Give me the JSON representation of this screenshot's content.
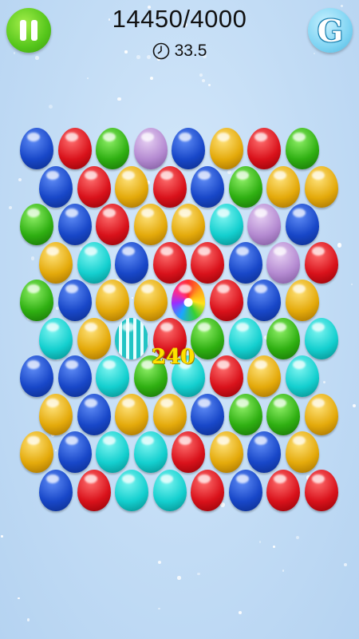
{
  "header": {
    "score": "14450/4000",
    "timer": "33.5",
    "hint_letter": "G"
  },
  "popup_points": "240",
  "colors": {
    "blue": "#1847c8",
    "red": "#d9121b",
    "green": "#2faf12",
    "yellow": "#e4aa0b",
    "cyan": "#14cfcf",
    "purple": "#b48ad1",
    "pause_button": "#55c61b",
    "hint_button": "#7fd4f3"
  },
  "board": {
    "rows": [
      [
        "blue",
        "red",
        "green",
        "purple",
        "blue",
        "yellow",
        "red",
        "green"
      ],
      [
        "blue",
        "red",
        "yellow",
        "red",
        "blue",
        "green",
        "yellow",
        "yellow"
      ],
      [
        "green",
        "blue",
        "red",
        "yellow",
        "yellow",
        "cyan",
        "purple",
        "blue"
      ],
      [
        "yellow",
        "cyan",
        "blue",
        "red",
        "red",
        "blue",
        "purple",
        "red"
      ],
      [
        "green",
        "blue",
        "yellow",
        "yellow",
        "swirl",
        "red",
        "blue",
        "yellow"
      ],
      [
        "cyan",
        "yellow",
        "striped",
        "red",
        "green",
        "cyan",
        "green",
        "cyan"
      ],
      [
        "blue",
        "blue",
        "cyan",
        "green",
        "cyan",
        "red",
        "yellow",
        "cyan"
      ],
      [
        "yellow",
        "blue",
        "yellow",
        "yellow",
        "blue",
        "green",
        "green",
        "yellow"
      ],
      [
        "yellow",
        "blue",
        "cyan",
        "cyan",
        "red",
        "yellow",
        "blue",
        "yellow"
      ],
      [
        "blue",
        "red",
        "cyan",
        "cyan",
        "red",
        "blue",
        "red",
        "red"
      ]
    ]
  }
}
